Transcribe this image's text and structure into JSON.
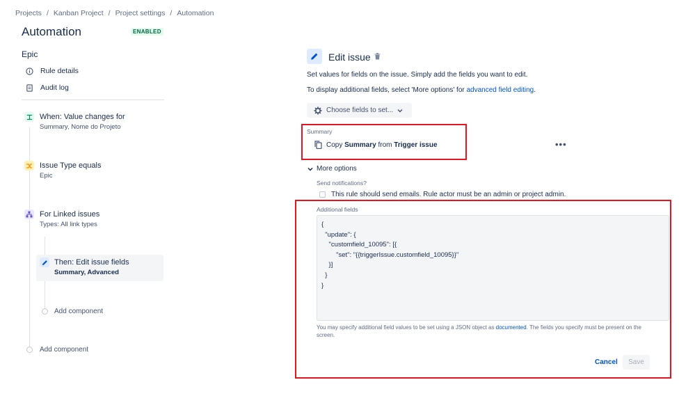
{
  "breadcrumbs": [
    "Projects",
    "Kanban Project",
    "Project settings",
    "Automation"
  ],
  "page": {
    "title": "Automation",
    "status": "ENABLED"
  },
  "sidebar": {
    "rule_name": "Epic",
    "links": [
      {
        "label": "Rule details",
        "icon": "info-icon"
      },
      {
        "label": "Audit log",
        "icon": "document-icon"
      }
    ],
    "steps": [
      {
        "title": "When: Value changes for",
        "subtitle": "Summary, Nome do Projeto",
        "icon": "trigger-icon",
        "color": "#e3fcef"
      },
      {
        "title": "Issue Type equals",
        "subtitle": "Epic",
        "icon": "shuffle-icon",
        "color": "#fff0b3"
      },
      {
        "title": "For Linked issues",
        "subtitle": "Types: All link types",
        "icon": "hierarchy-icon",
        "color": "#eae6ff"
      },
      {
        "title": "Then: Edit issue fields",
        "subtitle": "Summary, Advanced",
        "icon": "pencil-icon",
        "color": "#deebff"
      }
    ],
    "add_component_inner": "Add component",
    "add_component_outer": "Add component"
  },
  "editor": {
    "title": "Edit issue",
    "desc1": "Set values for fields on the issue. Simply add the fields you want to edit.",
    "desc2_prefix": "To display additional fields, select 'More options' for ",
    "desc2_link": "advanced field editing",
    "desc2_suffix": ".",
    "choose_button": "Choose fields to set...",
    "summary_label": "Summary",
    "copy_prefix": "Copy ",
    "copy_field": "Summary",
    "copy_mid": " from ",
    "copy_source": "Trigger issue",
    "more_dots": "•••",
    "more_options": "More options",
    "send_notifications_label": "Send notifications?",
    "send_notifications_text": "This rule should send emails. Rule actor must be an admin or project admin.",
    "additional_fields_label": "Additional fields",
    "json_value": "{\n  \"update\": {\n    \"customfield_10095\": [{\n        \"set\": \"{{triggerIssue.customfield_10095}}\"\n    }]\n  }\n}",
    "help_prefix": "You may specify additional field values to be set using a JSON object as ",
    "help_link": "documented",
    "help_suffix": ". The fields you specify must be present on the screen.",
    "cancel_label": "Cancel",
    "save_label": "Save"
  }
}
